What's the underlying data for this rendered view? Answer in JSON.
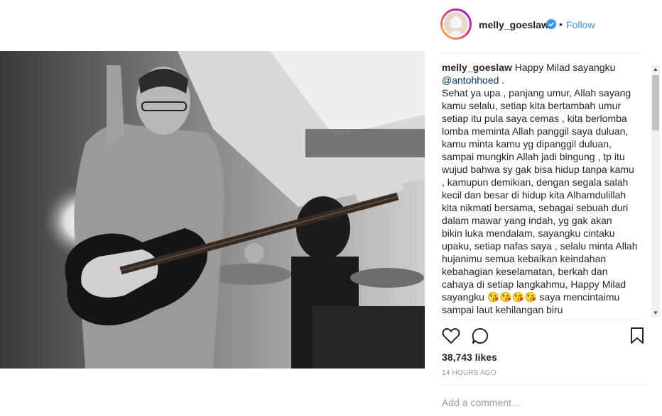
{
  "post": {
    "username": "melly_goeslaw",
    "separator": "•",
    "follow_label": "Follow"
  },
  "caption": {
    "username": "melly_goeslaw",
    "lines": [
      "Happy Milad sayangku",
      "@antohhoed .",
      "Sehat ya upa , panjang umur, Allah sayang",
      "kamu selalu, setiap kita bertambah umur",
      "setiap itu pula saya cemas , kita berlomba",
      "lomba meminta Allah panggil saya duluan,",
      "kamu minta kamu yg dipanggil duluan,",
      "sampai mungkin Allah jadi bingung , tp itu",
      "wujud bahwa sy gak bisa hidup tanpa kamu",
      ", kamupun demikian, dengan segala salah",
      "kecil dan besar di hidup kita Alhamdulillah",
      "kita nikmati bersama, sebagai sebuah duri",
      "dalam mawar yang indah, yg gak akan",
      "bikin luka mendalam, sayangku cintaku",
      "upaku, setiap nafas saya , selalu minta Allah",
      "hujanimu semua kebaikan keindahan",
      "kebahagian keselamatan, berkah dan",
      "cahaya di setiap langkahmu, Happy Milad",
      "sayangku",
      "saya mencintaimu",
      "sampai laut kehilangan biru"
    ],
    "emoji": "😘😘😘😘"
  },
  "scrollbar": {
    "up": "▲",
    "down": "▼"
  },
  "likes": "38,743 likes",
  "time": "14 HOURS AGO",
  "comment_placeholder": "Add a comment...",
  "icons": {
    "avatar": "avatar",
    "verified": "verified-badge-icon",
    "like": "heart-icon",
    "comment": "comment-icon",
    "save": "bookmark-icon"
  },
  "colors": {
    "link": "#3897f0",
    "mention": "#003569",
    "verified": "#3897f0"
  }
}
